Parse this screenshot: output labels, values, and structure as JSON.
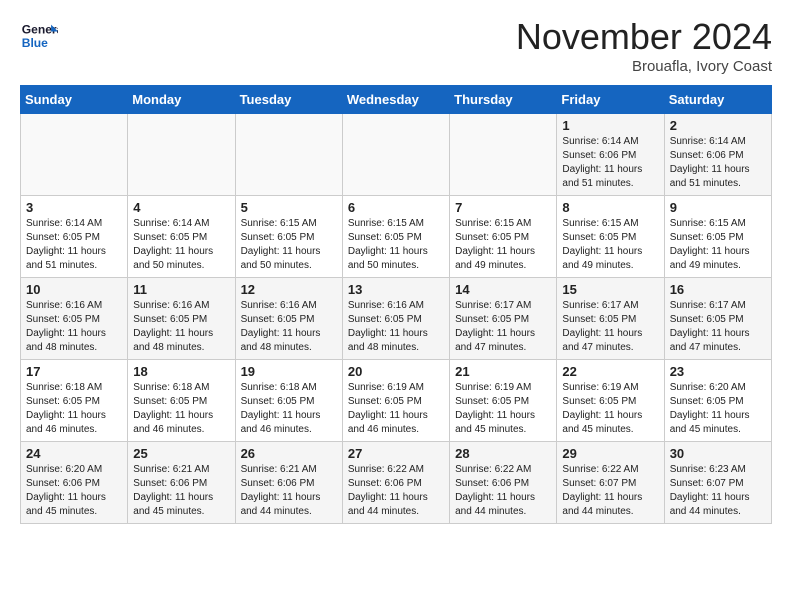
{
  "header": {
    "logo_line1": "General",
    "logo_line2": "Blue",
    "month": "November 2024",
    "location": "Brouafla, Ivory Coast"
  },
  "weekdays": [
    "Sunday",
    "Monday",
    "Tuesday",
    "Wednesday",
    "Thursday",
    "Friday",
    "Saturday"
  ],
  "weeks": [
    [
      {
        "day": "",
        "info": ""
      },
      {
        "day": "",
        "info": ""
      },
      {
        "day": "",
        "info": ""
      },
      {
        "day": "",
        "info": ""
      },
      {
        "day": "",
        "info": ""
      },
      {
        "day": "1",
        "info": "Sunrise: 6:14 AM\nSunset: 6:06 PM\nDaylight: 11 hours\nand 51 minutes."
      },
      {
        "day": "2",
        "info": "Sunrise: 6:14 AM\nSunset: 6:06 PM\nDaylight: 11 hours\nand 51 minutes."
      }
    ],
    [
      {
        "day": "3",
        "info": "Sunrise: 6:14 AM\nSunset: 6:05 PM\nDaylight: 11 hours\nand 51 minutes."
      },
      {
        "day": "4",
        "info": "Sunrise: 6:14 AM\nSunset: 6:05 PM\nDaylight: 11 hours\nand 50 minutes."
      },
      {
        "day": "5",
        "info": "Sunrise: 6:15 AM\nSunset: 6:05 PM\nDaylight: 11 hours\nand 50 minutes."
      },
      {
        "day": "6",
        "info": "Sunrise: 6:15 AM\nSunset: 6:05 PM\nDaylight: 11 hours\nand 50 minutes."
      },
      {
        "day": "7",
        "info": "Sunrise: 6:15 AM\nSunset: 6:05 PM\nDaylight: 11 hours\nand 49 minutes."
      },
      {
        "day": "8",
        "info": "Sunrise: 6:15 AM\nSunset: 6:05 PM\nDaylight: 11 hours\nand 49 minutes."
      },
      {
        "day": "9",
        "info": "Sunrise: 6:15 AM\nSunset: 6:05 PM\nDaylight: 11 hours\nand 49 minutes."
      }
    ],
    [
      {
        "day": "10",
        "info": "Sunrise: 6:16 AM\nSunset: 6:05 PM\nDaylight: 11 hours\nand 48 minutes."
      },
      {
        "day": "11",
        "info": "Sunrise: 6:16 AM\nSunset: 6:05 PM\nDaylight: 11 hours\nand 48 minutes."
      },
      {
        "day": "12",
        "info": "Sunrise: 6:16 AM\nSunset: 6:05 PM\nDaylight: 11 hours\nand 48 minutes."
      },
      {
        "day": "13",
        "info": "Sunrise: 6:16 AM\nSunset: 6:05 PM\nDaylight: 11 hours\nand 48 minutes."
      },
      {
        "day": "14",
        "info": "Sunrise: 6:17 AM\nSunset: 6:05 PM\nDaylight: 11 hours\nand 47 minutes."
      },
      {
        "day": "15",
        "info": "Sunrise: 6:17 AM\nSunset: 6:05 PM\nDaylight: 11 hours\nand 47 minutes."
      },
      {
        "day": "16",
        "info": "Sunrise: 6:17 AM\nSunset: 6:05 PM\nDaylight: 11 hours\nand 47 minutes."
      }
    ],
    [
      {
        "day": "17",
        "info": "Sunrise: 6:18 AM\nSunset: 6:05 PM\nDaylight: 11 hours\nand 46 minutes."
      },
      {
        "day": "18",
        "info": "Sunrise: 6:18 AM\nSunset: 6:05 PM\nDaylight: 11 hours\nand 46 minutes."
      },
      {
        "day": "19",
        "info": "Sunrise: 6:18 AM\nSunset: 6:05 PM\nDaylight: 11 hours\nand 46 minutes."
      },
      {
        "day": "20",
        "info": "Sunrise: 6:19 AM\nSunset: 6:05 PM\nDaylight: 11 hours\nand 46 minutes."
      },
      {
        "day": "21",
        "info": "Sunrise: 6:19 AM\nSunset: 6:05 PM\nDaylight: 11 hours\nand 45 minutes."
      },
      {
        "day": "22",
        "info": "Sunrise: 6:19 AM\nSunset: 6:05 PM\nDaylight: 11 hours\nand 45 minutes."
      },
      {
        "day": "23",
        "info": "Sunrise: 6:20 AM\nSunset: 6:05 PM\nDaylight: 11 hours\nand 45 minutes."
      }
    ],
    [
      {
        "day": "24",
        "info": "Sunrise: 6:20 AM\nSunset: 6:06 PM\nDaylight: 11 hours\nand 45 minutes."
      },
      {
        "day": "25",
        "info": "Sunrise: 6:21 AM\nSunset: 6:06 PM\nDaylight: 11 hours\nand 45 minutes."
      },
      {
        "day": "26",
        "info": "Sunrise: 6:21 AM\nSunset: 6:06 PM\nDaylight: 11 hours\nand 44 minutes."
      },
      {
        "day": "27",
        "info": "Sunrise: 6:22 AM\nSunset: 6:06 PM\nDaylight: 11 hours\nand 44 minutes."
      },
      {
        "day": "28",
        "info": "Sunrise: 6:22 AM\nSunset: 6:06 PM\nDaylight: 11 hours\nand 44 minutes."
      },
      {
        "day": "29",
        "info": "Sunrise: 6:22 AM\nSunset: 6:07 PM\nDaylight: 11 hours\nand 44 minutes."
      },
      {
        "day": "30",
        "info": "Sunrise: 6:23 AM\nSunset: 6:07 PM\nDaylight: 11 hours\nand 44 minutes."
      }
    ]
  ]
}
